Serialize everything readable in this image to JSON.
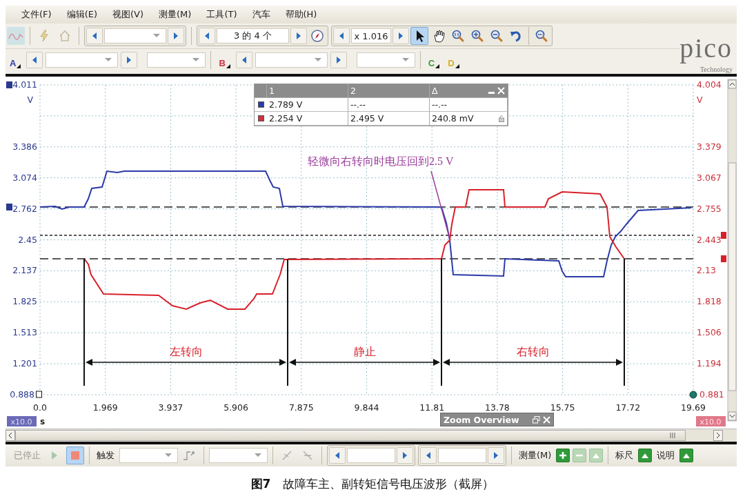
{
  "menu": [
    "文件(F)",
    "编辑(E)",
    "视图(V)",
    "测量(M)",
    "工具(T)",
    "汽车",
    "帮助(H)"
  ],
  "toolbar": {
    "buffer": "3 的 4 个",
    "zoom": "x 1.016",
    "tools": [
      {
        "kind": "pointer",
        "selected": true
      },
      {
        "kind": "hand",
        "selected": false
      },
      {
        "kind": "zoom-fit",
        "selected": false
      },
      {
        "kind": "zoom-in",
        "selected": false
      },
      {
        "kind": "zoom-out",
        "selected": false
      },
      {
        "kind": "undo",
        "selected": false
      }
    ]
  },
  "logo": {
    "name": "pico",
    "tagline": "Technology"
  },
  "channels": [
    {
      "label": "A",
      "color": "#2b3aa8"
    },
    {
      "label": "B",
      "color": "#d03040"
    },
    {
      "label": "C",
      "color": "#3a9a3a"
    },
    {
      "label": "D",
      "color": "#d8b020"
    }
  ],
  "plot": {
    "left_axis": {
      "unit": "V",
      "ticks": [
        "4.011",
        "3.386",
        "3.074",
        "2.762",
        "2.45",
        "2.137",
        "1.825",
        "1.513",
        "1.201",
        "0.888"
      ]
    },
    "right_axis": {
      "unit": "V",
      "ticks": [
        "4.004",
        "3.379",
        "3.067",
        "2.755",
        "2.443",
        "2.13",
        "1.818",
        "1.506",
        "1.194",
        "0.881"
      ]
    },
    "x_axis": {
      "unit": "s",
      "scale": "x10.0",
      "ticks": [
        "0.0",
        "1.969",
        "3.937",
        "5.906",
        "7.875",
        "9.844",
        "11.81",
        "13.78",
        "15.75",
        "17.72",
        "19.69"
      ]
    },
    "right_scale": "x10.0",
    "annotation": "轻微向右转向时电压回到2.5 V",
    "phases": [
      {
        "label": "左转向"
      },
      {
        "label": "静止"
      },
      {
        "label": "右转向"
      }
    ]
  },
  "measurements": {
    "columns": [
      "1",
      "2",
      "Δ"
    ],
    "rows": [
      {
        "color": "#2b3aa8",
        "values": [
          "2.789 V",
          "--.--",
          "--.--"
        ]
      },
      {
        "color": "#d03040",
        "values": [
          "2.254 V",
          "2.495 V",
          "240.8 mV"
        ]
      }
    ]
  },
  "zoom_overview": {
    "title": "Zoom Overview"
  },
  "bottom_bar": {
    "status": "已停止",
    "trigger": "触发",
    "measure": "测量(M)",
    "measure_buttons": [
      {
        "kind": "add",
        "disabled": false
      },
      {
        "kind": "remove",
        "disabled": true
      },
      {
        "kind": "edit",
        "disabled": true
      }
    ],
    "ruler": "标尺",
    "notes": "说明"
  },
  "caption": {
    "figure": "图7",
    "text": "故障车主、副转矩信号电压波形（截屏）"
  }
}
